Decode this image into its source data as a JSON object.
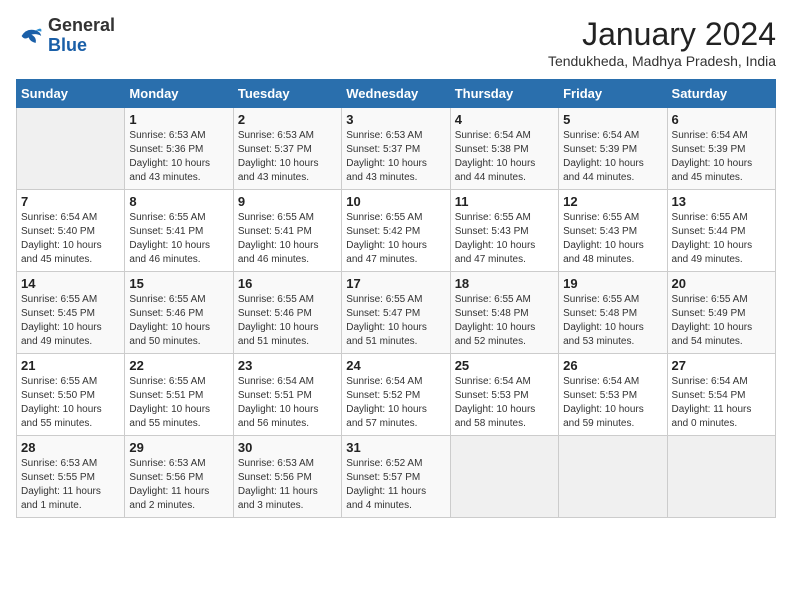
{
  "header": {
    "logo_general": "General",
    "logo_blue": "Blue",
    "month_year": "January 2024",
    "location": "Tendukheda, Madhya Pradesh, India"
  },
  "weekdays": [
    "Sunday",
    "Monday",
    "Tuesday",
    "Wednesday",
    "Thursday",
    "Friday",
    "Saturday"
  ],
  "weeks": [
    [
      {
        "day": "",
        "info": ""
      },
      {
        "day": "1",
        "info": "Sunrise: 6:53 AM\nSunset: 5:36 PM\nDaylight: 10 hours\nand 43 minutes."
      },
      {
        "day": "2",
        "info": "Sunrise: 6:53 AM\nSunset: 5:37 PM\nDaylight: 10 hours\nand 43 minutes."
      },
      {
        "day": "3",
        "info": "Sunrise: 6:53 AM\nSunset: 5:37 PM\nDaylight: 10 hours\nand 43 minutes."
      },
      {
        "day": "4",
        "info": "Sunrise: 6:54 AM\nSunset: 5:38 PM\nDaylight: 10 hours\nand 44 minutes."
      },
      {
        "day": "5",
        "info": "Sunrise: 6:54 AM\nSunset: 5:39 PM\nDaylight: 10 hours\nand 44 minutes."
      },
      {
        "day": "6",
        "info": "Sunrise: 6:54 AM\nSunset: 5:39 PM\nDaylight: 10 hours\nand 45 minutes."
      }
    ],
    [
      {
        "day": "7",
        "info": "Sunrise: 6:54 AM\nSunset: 5:40 PM\nDaylight: 10 hours\nand 45 minutes."
      },
      {
        "day": "8",
        "info": "Sunrise: 6:55 AM\nSunset: 5:41 PM\nDaylight: 10 hours\nand 46 minutes."
      },
      {
        "day": "9",
        "info": "Sunrise: 6:55 AM\nSunset: 5:41 PM\nDaylight: 10 hours\nand 46 minutes."
      },
      {
        "day": "10",
        "info": "Sunrise: 6:55 AM\nSunset: 5:42 PM\nDaylight: 10 hours\nand 47 minutes."
      },
      {
        "day": "11",
        "info": "Sunrise: 6:55 AM\nSunset: 5:43 PM\nDaylight: 10 hours\nand 47 minutes."
      },
      {
        "day": "12",
        "info": "Sunrise: 6:55 AM\nSunset: 5:43 PM\nDaylight: 10 hours\nand 48 minutes."
      },
      {
        "day": "13",
        "info": "Sunrise: 6:55 AM\nSunset: 5:44 PM\nDaylight: 10 hours\nand 49 minutes."
      }
    ],
    [
      {
        "day": "14",
        "info": "Sunrise: 6:55 AM\nSunset: 5:45 PM\nDaylight: 10 hours\nand 49 minutes."
      },
      {
        "day": "15",
        "info": "Sunrise: 6:55 AM\nSunset: 5:46 PM\nDaylight: 10 hours\nand 50 minutes."
      },
      {
        "day": "16",
        "info": "Sunrise: 6:55 AM\nSunset: 5:46 PM\nDaylight: 10 hours\nand 51 minutes."
      },
      {
        "day": "17",
        "info": "Sunrise: 6:55 AM\nSunset: 5:47 PM\nDaylight: 10 hours\nand 51 minutes."
      },
      {
        "day": "18",
        "info": "Sunrise: 6:55 AM\nSunset: 5:48 PM\nDaylight: 10 hours\nand 52 minutes."
      },
      {
        "day": "19",
        "info": "Sunrise: 6:55 AM\nSunset: 5:48 PM\nDaylight: 10 hours\nand 53 minutes."
      },
      {
        "day": "20",
        "info": "Sunrise: 6:55 AM\nSunset: 5:49 PM\nDaylight: 10 hours\nand 54 minutes."
      }
    ],
    [
      {
        "day": "21",
        "info": "Sunrise: 6:55 AM\nSunset: 5:50 PM\nDaylight: 10 hours\nand 55 minutes."
      },
      {
        "day": "22",
        "info": "Sunrise: 6:55 AM\nSunset: 5:51 PM\nDaylight: 10 hours\nand 55 minutes."
      },
      {
        "day": "23",
        "info": "Sunrise: 6:54 AM\nSunset: 5:51 PM\nDaylight: 10 hours\nand 56 minutes."
      },
      {
        "day": "24",
        "info": "Sunrise: 6:54 AM\nSunset: 5:52 PM\nDaylight: 10 hours\nand 57 minutes."
      },
      {
        "day": "25",
        "info": "Sunrise: 6:54 AM\nSunset: 5:53 PM\nDaylight: 10 hours\nand 58 minutes."
      },
      {
        "day": "26",
        "info": "Sunrise: 6:54 AM\nSunset: 5:53 PM\nDaylight: 10 hours\nand 59 minutes."
      },
      {
        "day": "27",
        "info": "Sunrise: 6:54 AM\nSunset: 5:54 PM\nDaylight: 11 hours\nand 0 minutes."
      }
    ],
    [
      {
        "day": "28",
        "info": "Sunrise: 6:53 AM\nSunset: 5:55 PM\nDaylight: 11 hours\nand 1 minute."
      },
      {
        "day": "29",
        "info": "Sunrise: 6:53 AM\nSunset: 5:56 PM\nDaylight: 11 hours\nand 2 minutes."
      },
      {
        "day": "30",
        "info": "Sunrise: 6:53 AM\nSunset: 5:56 PM\nDaylight: 11 hours\nand 3 minutes."
      },
      {
        "day": "31",
        "info": "Sunrise: 6:52 AM\nSunset: 5:57 PM\nDaylight: 11 hours\nand 4 minutes."
      },
      {
        "day": "",
        "info": ""
      },
      {
        "day": "",
        "info": ""
      },
      {
        "day": "",
        "info": ""
      }
    ]
  ]
}
